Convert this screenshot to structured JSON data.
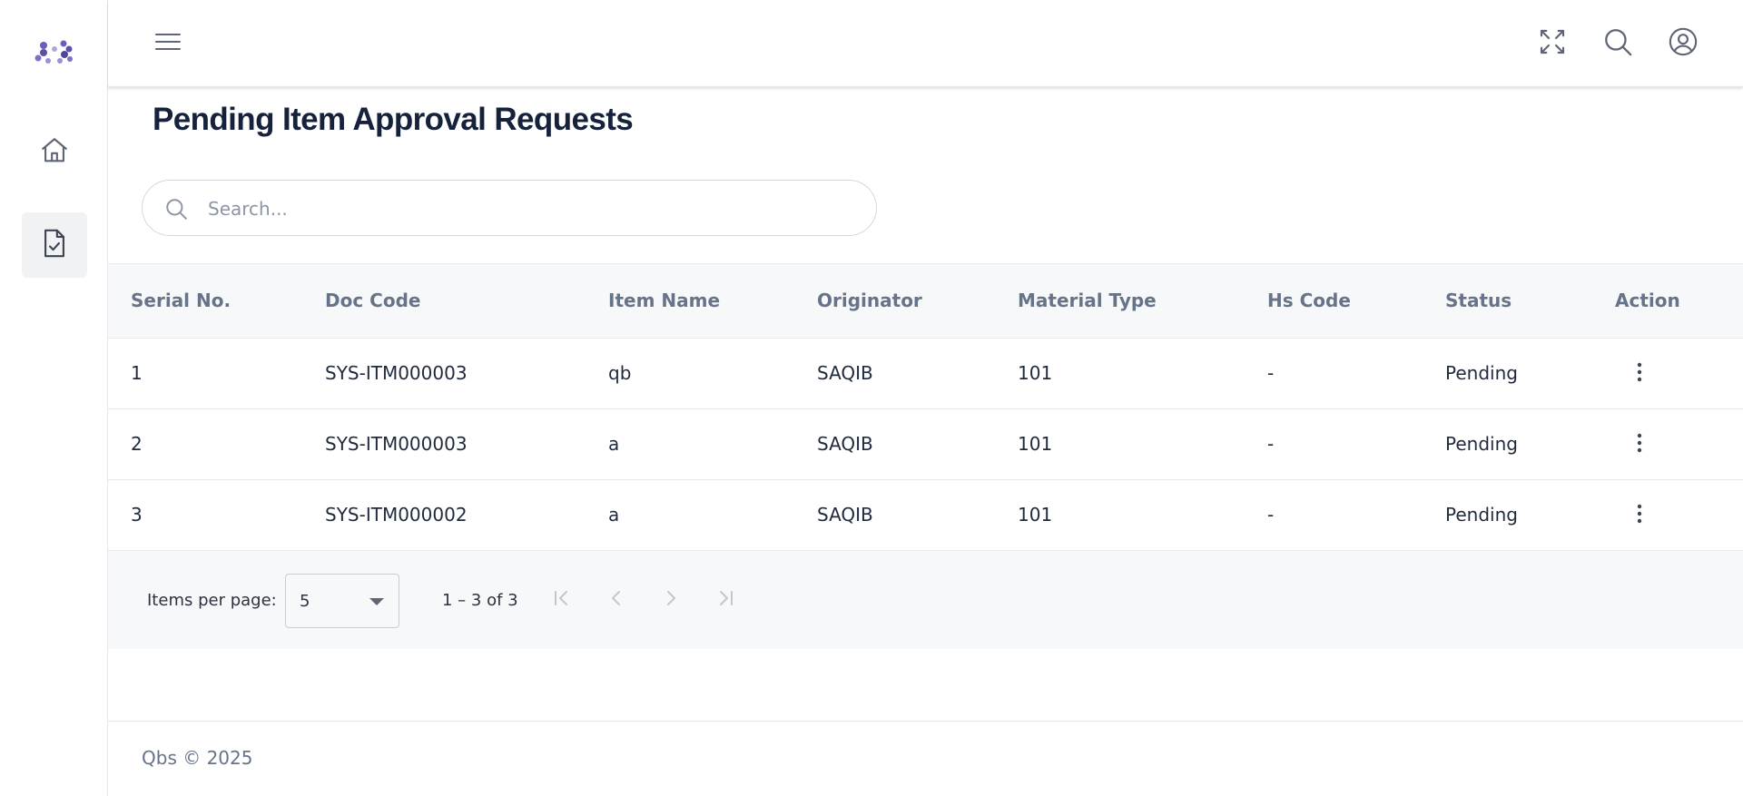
{
  "header": {
    "page_title": "Pending Item Approval Requests"
  },
  "sidebar": {
    "items": [
      {
        "name": "home",
        "icon": "home-icon"
      },
      {
        "name": "item-approvals",
        "icon": "document-check-icon",
        "active": true
      }
    ]
  },
  "topbar": {
    "icons": [
      "menu-icon",
      "fullscreen-icon",
      "search-icon",
      "user-circle-icon"
    ]
  },
  "search": {
    "placeholder": "Search..."
  },
  "table": {
    "columns": [
      "Serial No.",
      "Doc Code",
      "Item Name",
      "Originator",
      "Material Type",
      "Hs Code",
      "Status",
      "Action"
    ],
    "rows": [
      {
        "serial": "1",
        "doc_code": "SYS-ITM000003",
        "item_name": "qb",
        "originator": "SAQIB",
        "material_type": "101",
        "hs_code": "-",
        "status": "Pending"
      },
      {
        "serial": "2",
        "doc_code": "SYS-ITM000003",
        "item_name": "a",
        "originator": "SAQIB",
        "material_type": "101",
        "hs_code": "-",
        "status": "Pending"
      },
      {
        "serial": "3",
        "doc_code": "SYS-ITM000002",
        "item_name": "a",
        "originator": "SAQIB",
        "material_type": "101",
        "hs_code": "-",
        "status": "Pending"
      }
    ]
  },
  "paginator": {
    "items_per_page_label": "Items per page:",
    "items_per_page_value": "5",
    "range_label": "1 – 3 of 3"
  },
  "footer": {
    "text": "Qbs © 2025"
  },
  "colors": {
    "title": "#16213b",
    "header_text": "#667389",
    "row_text": "#1f2a3d",
    "table_header_bg": "#f7f8fa",
    "active_nav_bg": "#f1f2f4",
    "logo_purple": "#6a5fb8"
  }
}
